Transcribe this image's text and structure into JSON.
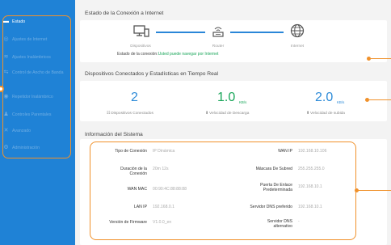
{
  "sidebar": {
    "items": [
      {
        "label": "Estado",
        "icon": "dashboard-icon"
      },
      {
        "label": "Ajustes de Internet",
        "icon": "globe-icon"
      },
      {
        "label": "Ajustes Inalámbricos",
        "icon": "wifi-icon"
      },
      {
        "label": "Control de Ancho de Banda",
        "icon": "bandwidth-icon"
      },
      {
        "label": "Repetidor Inalámbrico",
        "icon": "repeater-icon"
      },
      {
        "label": "Controles Parentales",
        "icon": "parental-icon"
      },
      {
        "label": "Avanzado",
        "icon": "tools-icon"
      },
      {
        "label": "Administración",
        "icon": "admin-icon"
      }
    ]
  },
  "connection": {
    "title": "Estado de la Conexión a Internet",
    "devices_label": "Dispositivos",
    "router_label": "Router",
    "internet_label": "Internet",
    "status_prefix": "Estado de la conexión:",
    "status_text": "Usted puede navegar por Internet"
  },
  "stats": {
    "title": "Dispositivos Conectados y Estadísticas en Tiempo Real",
    "devices_count": "2",
    "devices_label": "Dispositivos Conectados",
    "download_value": "1.0",
    "download_unit": "KB/s",
    "download_label": "Velocidad de Descarga",
    "upload_value": "2.0",
    "upload_unit": "KB/s",
    "upload_label": "Velocidad de subida"
  },
  "system": {
    "title": "Información del Sistema",
    "left": [
      {
        "label": "Tipo de Conexión",
        "value": "IP Dinámica"
      },
      {
        "label": "Duración de la Conexión",
        "value": "20m 12s"
      },
      {
        "label": "WAN MAC",
        "value": "00:90:4C:88:88:88"
      },
      {
        "label": "LAN IP",
        "value": "192.168.0.1"
      },
      {
        "label": "Versión de Firmware",
        "value": "V1.0.0_en"
      }
    ],
    "right": [
      {
        "label": "WAN IP",
        "value": "192.168.10.106"
      },
      {
        "label": "Máscara De Subred",
        "value": "255.255.255.0"
      },
      {
        "label": "Puerta De Enlace Predeterminada",
        "value": "192.168.10.1"
      },
      {
        "label": "Servidor DNS preferido",
        "value": "192.168.10.1"
      },
      {
        "label": "Servidor DNS alternativo",
        "value": "-"
      }
    ]
  },
  "colors": {
    "sidebar": "#1f82d6",
    "accent": "#f0912b",
    "blue": "#2d8bd8",
    "green": "#1aa65a"
  }
}
